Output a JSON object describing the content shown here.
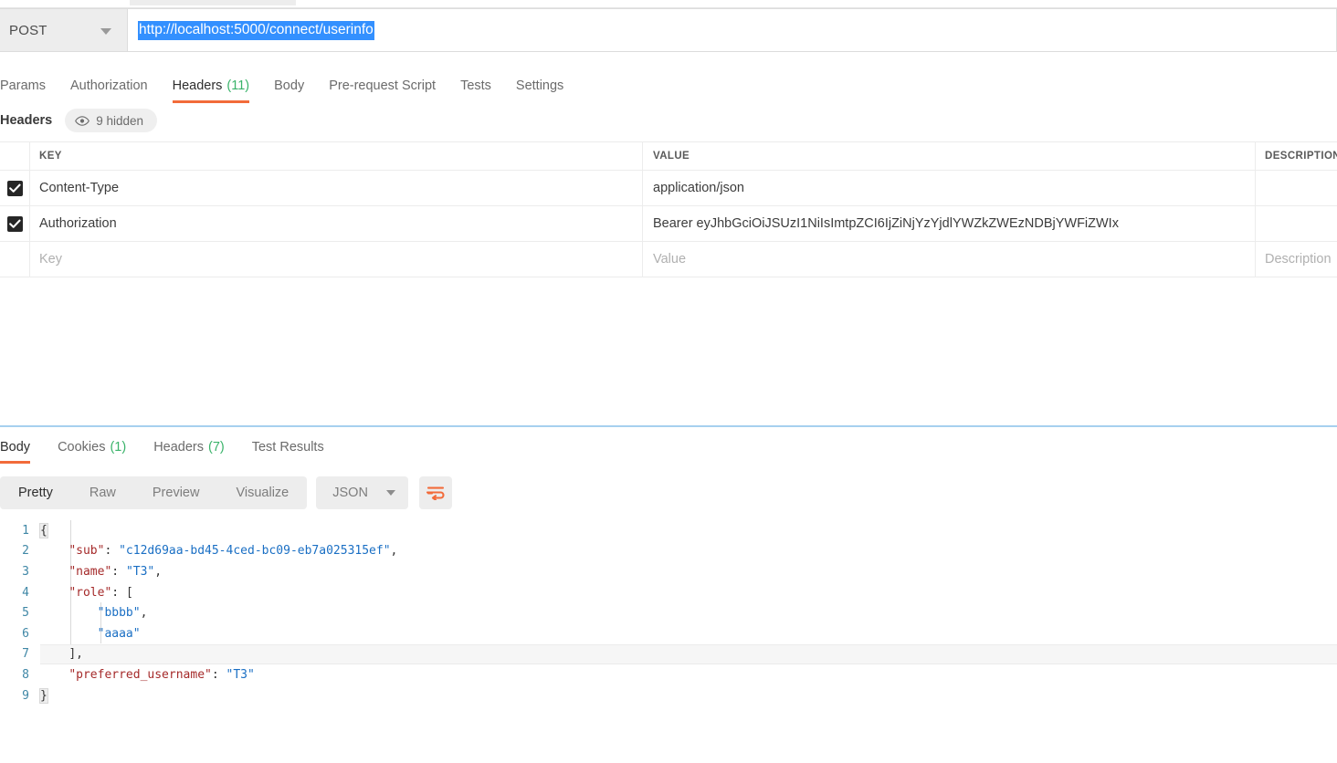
{
  "request": {
    "method": "POST",
    "url": "http://localhost:5000/connect/userinfo",
    "tabs": [
      {
        "label": "Params",
        "count": "",
        "active": false
      },
      {
        "label": "Authorization",
        "count": "",
        "active": false
      },
      {
        "label": "Headers",
        "count": "(11)",
        "active": true
      },
      {
        "label": "Body",
        "count": "",
        "active": false
      },
      {
        "label": "Pre-request Script",
        "count": "",
        "active": false
      },
      {
        "label": "Tests",
        "count": "",
        "active": false
      },
      {
        "label": "Settings",
        "count": "",
        "active": false
      }
    ],
    "headers_section": {
      "title": "Headers",
      "hidden_badge": "9 hidden",
      "hidden_icon": "eye-icon"
    },
    "table": {
      "columns": [
        "KEY",
        "VALUE",
        "DESCRIPTION"
      ],
      "rows": [
        {
          "checked": true,
          "key": "Content-Type",
          "value": "application/json",
          "description": ""
        },
        {
          "checked": true,
          "key": "Authorization",
          "value": "Bearer eyJhbGciOiJSUzI1NiIsImtpZCI6IjZiNjYzYjdlYWZkZWEzNDBjYWFiZWIx",
          "description": ""
        }
      ],
      "placeholder_row": {
        "key": "Key",
        "value": "Value",
        "description": "Description"
      }
    }
  },
  "response": {
    "tabs": [
      {
        "label": "Body",
        "count": "",
        "active": true
      },
      {
        "label": "Cookies",
        "count": "(1)",
        "active": false
      },
      {
        "label": "Headers",
        "count": "(7)",
        "active": false
      },
      {
        "label": "Test Results",
        "count": "",
        "active": false
      }
    ],
    "format_tabs": [
      {
        "label": "Pretty",
        "active": true
      },
      {
        "label": "Raw",
        "active": false
      },
      {
        "label": "Preview",
        "active": false
      },
      {
        "label": "Visualize",
        "active": false
      }
    ],
    "language": "JSON",
    "wrap_icon": "word-wrap-icon",
    "body_lines": [
      {
        "n": "1",
        "segments": [
          {
            "t": "{",
            "c": "punc",
            "brace": true
          }
        ]
      },
      {
        "n": "2",
        "segments": [
          {
            "t": "    ",
            "c": "punc"
          },
          {
            "t": "\"sub\"",
            "c": "key"
          },
          {
            "t": ": ",
            "c": "punc"
          },
          {
            "t": "\"c12d69aa-bd45-4ced-bc09-eb7a025315ef\"",
            "c": "str"
          },
          {
            "t": ",",
            "c": "punc"
          }
        ]
      },
      {
        "n": "3",
        "segments": [
          {
            "t": "    ",
            "c": "punc"
          },
          {
            "t": "\"name\"",
            "c": "key"
          },
          {
            "t": ": ",
            "c": "punc"
          },
          {
            "t": "\"T3\"",
            "c": "str"
          },
          {
            "t": ",",
            "c": "punc"
          }
        ]
      },
      {
        "n": "4",
        "segments": [
          {
            "t": "    ",
            "c": "punc"
          },
          {
            "t": "\"role\"",
            "c": "key"
          },
          {
            "t": ": ",
            "c": "punc"
          },
          {
            "t": "[",
            "c": "punc"
          }
        ]
      },
      {
        "n": "5",
        "segments": [
          {
            "t": "        ",
            "c": "punc"
          },
          {
            "t": "\"bbbb\"",
            "c": "str"
          },
          {
            "t": ",",
            "c": "punc"
          }
        ]
      },
      {
        "n": "6",
        "segments": [
          {
            "t": "        ",
            "c": "punc"
          },
          {
            "t": "\"aaaa\"",
            "c": "str"
          }
        ]
      },
      {
        "n": "7",
        "highlight": true,
        "segments": [
          {
            "t": "    ",
            "c": "punc"
          },
          {
            "t": "],",
            "c": "punc"
          }
        ]
      },
      {
        "n": "8",
        "segments": [
          {
            "t": "    ",
            "c": "punc"
          },
          {
            "t": "\"preferred_username\"",
            "c": "key"
          },
          {
            "t": ": ",
            "c": "punc"
          },
          {
            "t": "\"T3\"",
            "c": "str"
          }
        ]
      },
      {
        "n": "9",
        "segments": [
          {
            "t": "}",
            "c": "punc",
            "brace": true
          }
        ]
      }
    ]
  },
  "colors": {
    "accent": "#f26b3a",
    "count_green": "#3ab36a",
    "selection_blue": "#3390ff",
    "splitter_blue": "#a6d0ef",
    "json_key": "#a52a2a",
    "json_string": "#1a6fc4",
    "line_number": "#3f87a6"
  }
}
